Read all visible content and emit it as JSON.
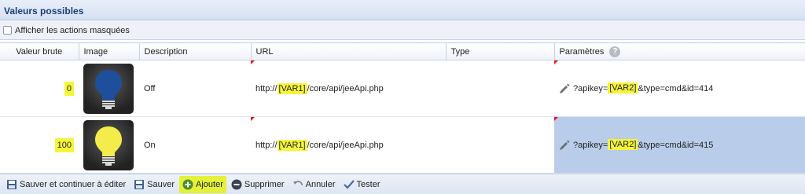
{
  "panel": {
    "title": "Valeurs possibles"
  },
  "toggle": {
    "label": "Afficher les actions masquées"
  },
  "table": {
    "headers": {
      "valeur_brute": "Valeur brute",
      "image": "Image",
      "description": "Description",
      "url": "URL",
      "type": "Type",
      "parametres": "Paramètres"
    },
    "rows": [
      {
        "value": "0",
        "icon": "lightbulb-off-icon",
        "bulb_color": "#1d4f9a",
        "description": "Off",
        "url_prefix": "http://",
        "url_var": "[VAR1]",
        "url_suffix": "/core/api/jeeApi.php",
        "type": "",
        "param_prefix": "?apikey=",
        "param_var": "[VAR2]",
        "param_suffix": "&type=cmd&id=414",
        "selected": false
      },
      {
        "value": "100",
        "icon": "lightbulb-on-icon",
        "bulb_color": "#f4ec4a",
        "description": "On",
        "url_prefix": "http://",
        "url_var": "[VAR1]",
        "url_suffix": "/core/api/jeeApi.php",
        "type": "",
        "param_prefix": "?apikey=",
        "param_var": "[VAR2]",
        "param_suffix": "&type=cmd&id=415",
        "selected": true
      }
    ]
  },
  "toolbar": {
    "save_continue": "Sauver et continuer à éditer",
    "save": "Sauver",
    "add": "Ajouter",
    "delete": "Supprimer",
    "cancel": "Annuler",
    "test": "Tester"
  },
  "colors": {
    "highlight": "#f5f53a",
    "header_text": "#1c3f78",
    "selection": "#b9cdea",
    "add_icon": "#4b8f2a",
    "delete_icon": "#3a4252"
  }
}
